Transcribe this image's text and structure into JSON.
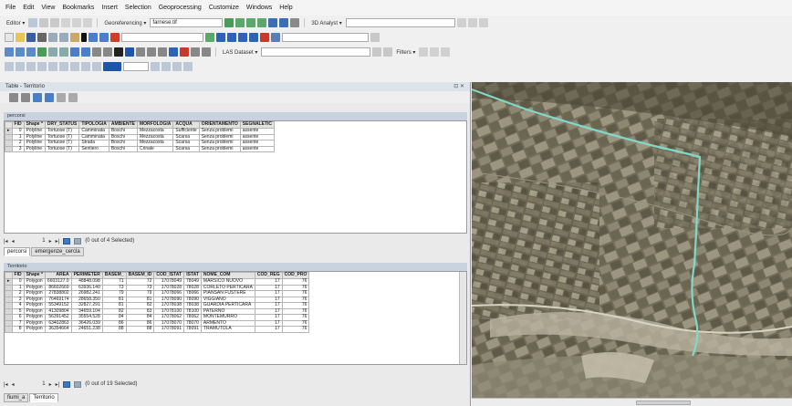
{
  "menu": [
    "File",
    "Edit",
    "View",
    "Bookmarks",
    "Insert",
    "Selection",
    "Geoprocessing",
    "Customize",
    "Windows",
    "Help"
  ],
  "toolbar": {
    "editor_label": "Editor ▾",
    "georef_label": "Georeferencing ▾",
    "georef_layer": "farnese.tif",
    "analyst_label": "3D Analyst ▾",
    "las_label": "LAS Dataset ▾",
    "filters_label": "Filters ▾"
  },
  "table_window": {
    "title": "Table - Territorio",
    "close": "⊡ ✕"
  },
  "table1": {
    "name": "percorsi",
    "columns": [
      "FID",
      "Shape *",
      "DRY_STATUS",
      "TIPOLOGIA",
      "AMBIENTE",
      "MORFOLOGIA",
      "ACQUA",
      "ORIENTAMENTO",
      "SEGNALETIC"
    ],
    "rows": [
      [
        "0",
        "Polyline",
        "Tortuose (T)",
        "Camminata",
        "Boschi",
        "Mezzacosta",
        "Sufficiente",
        "Senza problemi",
        "assente"
      ],
      [
        "1",
        "Polyline",
        "Tortuose (T)",
        "Camminata",
        "Boschi",
        "Mezzacosta",
        "Scarsa",
        "Senza problemi",
        "assente"
      ],
      [
        "2",
        "Polyline",
        "Tortuose (T)",
        "Strada",
        "Boschi",
        "Mezzacosta",
        "Scarsa",
        "Senza problemi",
        "assente"
      ],
      [
        "3",
        "Polyline",
        "Tortuose (T)",
        "Sentiero",
        "Boschi",
        "Crinale",
        "Scarsa",
        "Senza problemi",
        "assente"
      ]
    ],
    "nav_record": "1",
    "status": "(0 out of 4 Selected)"
  },
  "tabs1": [
    "percorsi",
    "emergenze_cercla"
  ],
  "table2": {
    "name": "Territorio",
    "columns": [
      "FID",
      "Shape *",
      "AREA",
      "PERIMETER",
      "BASEM_",
      "BASEM_ID",
      "COD_ISTAT",
      "ISTAT",
      "NOME_COM",
      "COD_REG",
      "COD_PRO"
    ],
    "rows": [
      [
        "0",
        "Polygon",
        "6603127.0",
        "48848.098",
        "71",
        "72",
        "17078049",
        "78049",
        "MARSICO NUOVO",
        "17",
        "76"
      ],
      [
        "1",
        "Polygon",
        "86602669",
        "63936.140",
        "73",
        "73",
        "17078028",
        "78028",
        "CORLETO PERTICARA",
        "17",
        "76"
      ],
      [
        "2",
        "Polygon",
        "27838802",
        "26982.241",
        "79",
        "79",
        "17078066",
        "78066",
        "PIANSAN FUSTERE",
        "17",
        "76"
      ],
      [
        "3",
        "Polygon",
        "76469174",
        "28658.350",
        "81",
        "81",
        "17078090",
        "78090",
        "VIGGIANO",
        "17",
        "76"
      ],
      [
        "4",
        "Polygon",
        "55349152",
        "32827.291",
        "81",
        "82",
        "17078038",
        "78038",
        "GUARDIA PERTICARA",
        "17",
        "76"
      ],
      [
        "5",
        "Polygon",
        "41309804",
        "34659.104",
        "82",
        "83",
        "17078100",
        "78100",
        "PATERNO",
        "17",
        "76"
      ],
      [
        "6",
        "Polygon",
        "56391452",
        "35554.528",
        "84",
        "84",
        "17078062",
        "78062",
        "MONTEMURRO",
        "17",
        "76"
      ],
      [
        "7",
        "Polygon",
        "63402863",
        "36426.039",
        "86",
        "86",
        "17078070",
        "78070",
        "ARMENTO",
        "17",
        "76"
      ],
      [
        "8",
        "Polygon",
        "36354664",
        "24651.238",
        "88",
        "88",
        "17078091",
        "78091",
        "TRAMUTOLA",
        "17",
        "76"
      ]
    ],
    "nav_record": "1",
    "status": "(0 out of 19 Selected)"
  },
  "tabs2": [
    "fiumi_a",
    "Territorio"
  ],
  "colors": {
    "route": "#7fd8c8",
    "map_base": "#6f6a58"
  }
}
